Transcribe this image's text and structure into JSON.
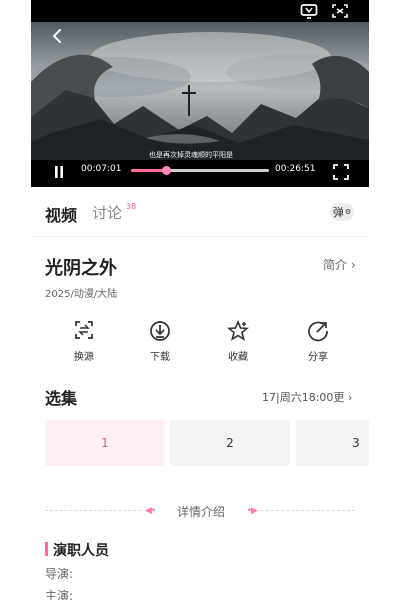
{
  "player": {
    "subtitle": "也是再次掉灵魂顺的平阳是",
    "current_time": "00:07:01",
    "duration": "00:26:51",
    "progress": 0.25,
    "icons": [
      "back-icon",
      "tv-icon",
      "rotate-icon",
      "pause-icon",
      "fullscreen-icon"
    ]
  },
  "tabs": {
    "video": "视频",
    "discussion": "讨论",
    "discussion_count": "38",
    "danmu_label": "弹"
  },
  "show": {
    "title": "光阴之外",
    "intro_link": "简介",
    "meta": "2025/动漫/大陆"
  },
  "actions": [
    {
      "label": "换源"
    },
    {
      "label": "下载"
    },
    {
      "label": "收藏"
    },
    {
      "label": "分享"
    }
  ],
  "episodes": {
    "title": "选集",
    "schedule": "17|周六18:00更",
    "items": [
      "1",
      "2",
      "3"
    ],
    "selected_index": 0
  },
  "details": {
    "label": "详情介绍"
  },
  "cast": {
    "title": "演职人员",
    "director_label": "导演:",
    "actor_label": "主演:"
  },
  "colors": {
    "accent": "#ff6aa3",
    "active_episode_bg": "#ffeef5",
    "episode_bg": "#f4f4f4"
  }
}
